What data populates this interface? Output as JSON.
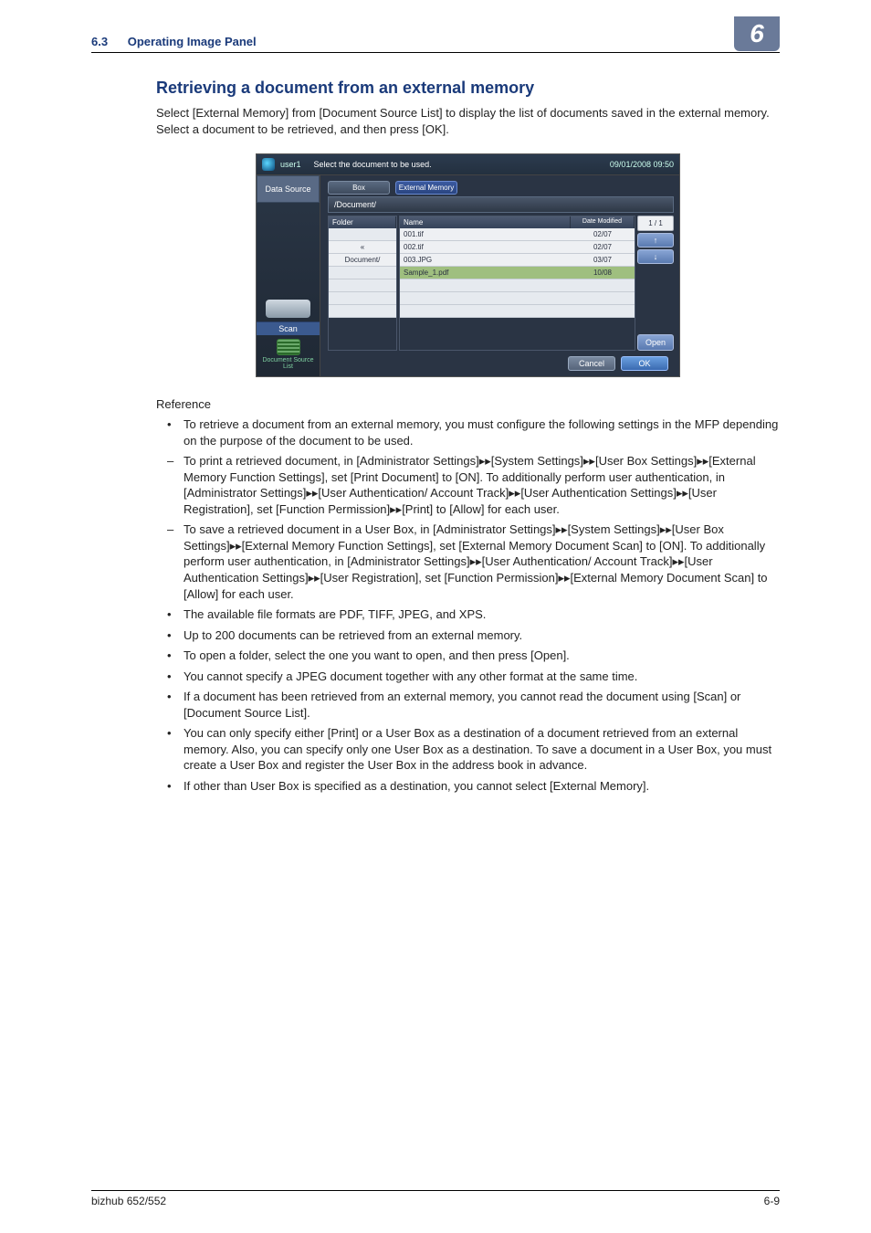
{
  "header": {
    "section_num": "6.3",
    "section_title": "Operating Image Panel",
    "chapter_num": "6"
  },
  "page": {
    "heading": "Retrieving a document from an external memory",
    "intro": "Select [External Memory] from [Document Source List] to display the list of documents saved in the external memory. Select a document to be retrieved, and then press [OK]."
  },
  "panel": {
    "user": "user1",
    "instruction": "Select the document to be used.",
    "datetime": "09/01/2008 09:50",
    "side_header": "Data Source",
    "scan_label": "Scan",
    "doclist_label": "Document Source List",
    "tabs": {
      "box": "Box",
      "external": "External Memory"
    },
    "path": "/Document/",
    "col_folder": "Folder",
    "col_name": "Name",
    "col_date": "Date Modified",
    "folders": [
      "",
      "«",
      "Document/",
      "",
      "",
      "",
      ""
    ],
    "files": [
      {
        "name": "001.tif",
        "date": "02/07",
        "sel": false
      },
      {
        "name": "002.tif",
        "date": "02/07",
        "sel": false
      },
      {
        "name": "003.JPG",
        "date": "03/07",
        "sel": false
      },
      {
        "name": "Sample_1.pdf",
        "date": "10/08",
        "sel": true
      },
      {
        "name": "",
        "date": "",
        "sel": false
      },
      {
        "name": "",
        "date": "",
        "sel": false
      },
      {
        "name": "",
        "date": "",
        "sel": false
      }
    ],
    "pager": "1 /  1",
    "arrow_up": "↑",
    "arrow_down": "↓",
    "open": "Open",
    "cancel": "Cancel",
    "ok": "OK"
  },
  "reference": {
    "heading": "Reference",
    "bullets_top": [
      "To retrieve a document from an external memory, you must configure the following settings in the MFP depending on the purpose of the document to be used."
    ],
    "dashes": [
      "To print a retrieved document, in [Administrator Settings]▸▸[System Settings]▸▸[User Box Settings]▸▸[External Memory Function Settings], set [Print Document] to [ON]. To additionally perform user authentication, in [Administrator Settings]▸▸[User Authentication/ Account Track]▸▸[User Authentication Settings]▸▸[User Registration], set [Function Permission]▸▸[Print] to [Allow] for each user.",
      "To save a retrieved document in a User Box, in [Administrator Settings]▸▸[System Settings]▸▸[User Box Settings]▸▸[External Memory Function Settings], set [External Memory Document Scan] to [ON].  To additionally perform user authentication, in [Administrator Settings]▸▸[User Authentication/ Account Track]▸▸[User Authentication Settings]▸▸[User Registration], set [Function Permission]▸▸[External Memory Document Scan] to [Allow] for each user."
    ],
    "bullets_rest": [
      "The available file formats are PDF, TIFF, JPEG, and XPS.",
      "Up to 200 documents can be retrieved from an external memory.",
      "To open a folder, select the one you want to open, and then press [Open].",
      "You cannot specify a JPEG document together with any other format at the same time.",
      "If a document has been retrieved from an external memory, you cannot read the document using [Scan] or [Document Source List].",
      "You can only specify either [Print] or a User Box as a destination of a document retrieved from an external memory. Also, you can specify only one User Box as a destination. To save a document in a User Box, you must create a User Box and register the User Box in the address book in advance.",
      "If other than User Box is specified as a destination, you cannot select [External Memory]."
    ]
  },
  "footer": {
    "left": "bizhub 652/552",
    "right": "6-9"
  }
}
